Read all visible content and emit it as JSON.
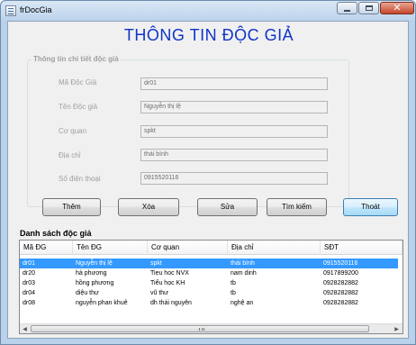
{
  "window": {
    "title": "frDocGia",
    "icon": "form-icon",
    "controls": [
      "minimize-icon",
      "maximize-icon",
      "close-icon"
    ]
  },
  "form": {
    "heading": "THÔNG TIN ĐỘC GIẢ",
    "heading_color": "#1034c8",
    "group_title": "Thông tin chi tiết độc giả",
    "fields": [
      {
        "label": "Mã Độc Giả",
        "value": "dr01"
      },
      {
        "label": "Tên Độc giả",
        "value": "Nguyễn thị lệ"
      },
      {
        "label": "Cơ quan",
        "value": "spkt"
      },
      {
        "label": "Địa chỉ",
        "value": "thái bình"
      },
      {
        "label": "Số điện thoại",
        "value": "0915520116"
      }
    ]
  },
  "buttons": {
    "add": "Thêm",
    "delete": "Xóa",
    "edit": "Sửa",
    "search": "Tìm kiếm",
    "exit": "Thoát"
  },
  "list": {
    "heading": "Danh sách độc giả",
    "columns": [
      "Mã ĐG",
      "Tên ĐG",
      "Cơ quan",
      "Địa chỉ",
      "SĐT"
    ],
    "rows": [
      [
        "dr01",
        "Nguyễn thị lệ",
        "spkt",
        "thái bình",
        "0915520116"
      ],
      [
        "dr20",
        "hà phương",
        "Tieu hoc NVX",
        "nam dinh",
        "0917899200"
      ],
      [
        "dr03",
        "hồng phương",
        "Tiểu học KH",
        "tb",
        "0928282882"
      ],
      [
        "dr04",
        "diệu thư",
        "vũ thư",
        "tb",
        "0928282882"
      ],
      [
        "dr08",
        "nguyễn phan khuê",
        "dh thái nguyên",
        "nghệ an",
        "0928282882"
      ]
    ],
    "selected_row": 0,
    "selection_color": "#3399ff"
  }
}
